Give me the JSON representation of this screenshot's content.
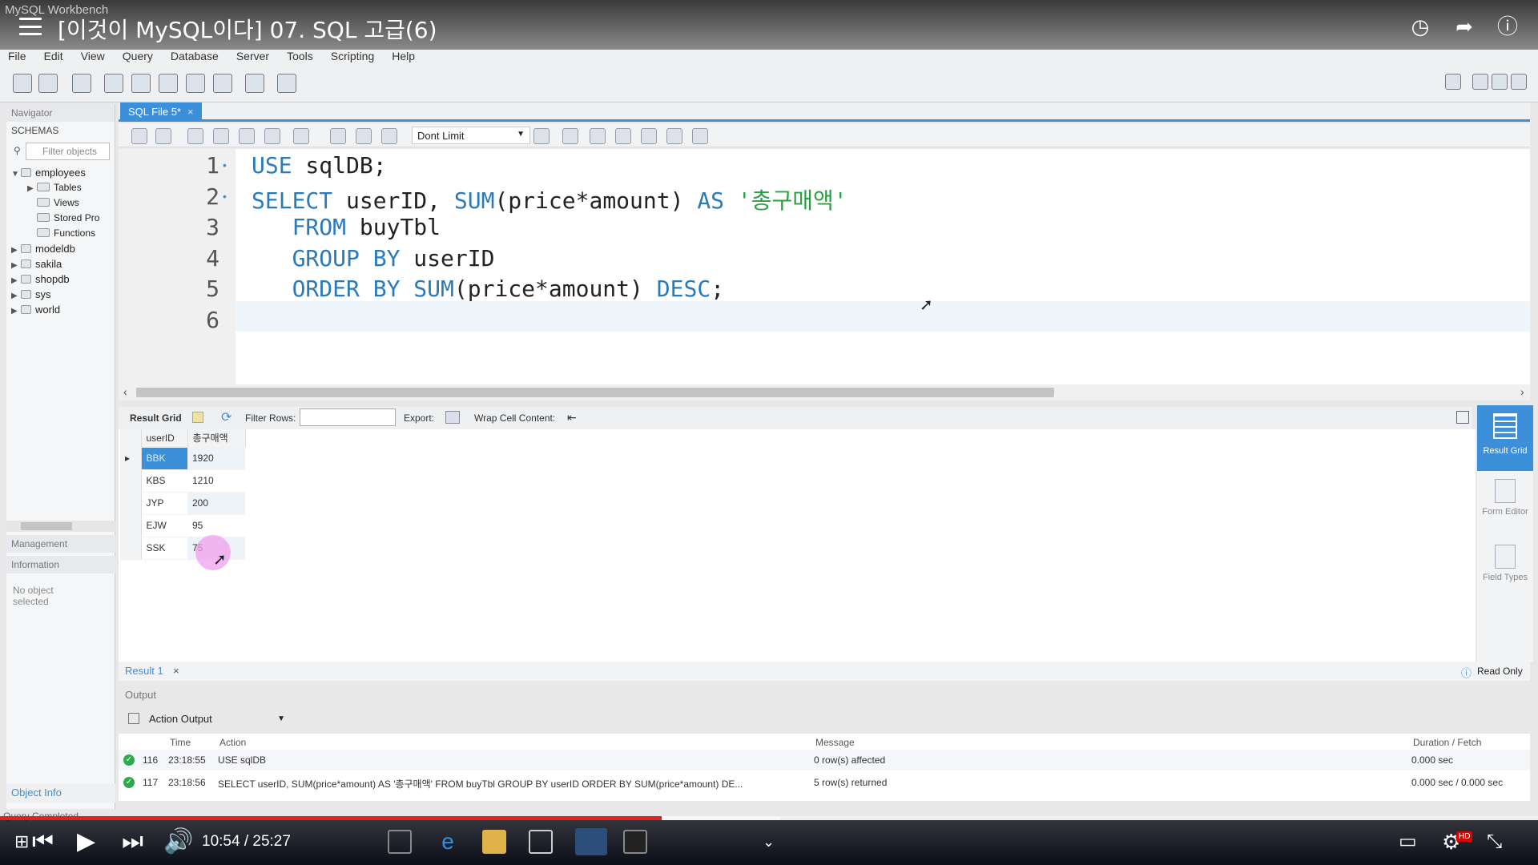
{
  "app": {
    "window_title": "MySQL Workbench",
    "video_title": "[이것이 MySQL이다] 07. SQL 고급(6)"
  },
  "menu": [
    "File",
    "Edit",
    "View",
    "Query",
    "Database",
    "Server",
    "Tools",
    "Scripting",
    "Help"
  ],
  "navigator": {
    "header": "Navigator",
    "schemas_label": "SCHEMAS",
    "filter_placeholder": "Filter objects",
    "schemas": [
      {
        "name": "employees",
        "expanded": true,
        "children": [
          "Tables",
          "Views",
          "Stored Pro",
          "Functions"
        ]
      },
      {
        "name": "modeldb"
      },
      {
        "name": "sakila"
      },
      {
        "name": "shopdb"
      },
      {
        "name": "sys"
      },
      {
        "name": "world"
      }
    ],
    "management_label": "Management",
    "information_label": "Information",
    "no_object": "No object selected",
    "object_info": "Object Info"
  },
  "editor": {
    "tab_label": "SQL File 5*",
    "limit_value": "Dont Limit",
    "lines": [
      {
        "n": "1",
        "html": "<span class='kw'>USE</span> sqlDB;"
      },
      {
        "n": "2",
        "html": "<span class='kw'>SELECT</span> userID, <span class='kw'>SUM</span>(price*amount) <span class='kw'>AS</span> <span class='str'>'총구매액'</span>"
      },
      {
        "n": "3",
        "html": "   <span class='kw'>FROM</span> buyTbl"
      },
      {
        "n": "4",
        "html": "   <span class='kw'>GROUP BY</span> userID"
      },
      {
        "n": "5",
        "html": "   <span class='kw'>ORDER BY</span> <span class='kw'>SUM</span>(price*amount) <span class='kw'>DESC</span>;"
      },
      {
        "n": "6",
        "html": ""
      }
    ]
  },
  "result_toolbar": {
    "result_grid": "Result Grid",
    "filter_rows": "Filter Rows:",
    "export": "Export:",
    "wrap": "Wrap Cell Content:"
  },
  "result": {
    "columns": [
      "userID",
      "총구매액"
    ],
    "rows": [
      [
        "BBK",
        "1920"
      ],
      [
        "KBS",
        "1210"
      ],
      [
        "JYP",
        "200"
      ],
      [
        "EJW",
        "95"
      ],
      [
        "SSK",
        "75"
      ]
    ],
    "tab_label": "Result 1",
    "read_only": "Read Only",
    "side": [
      "Result Grid",
      "Form Editor",
      "Field Types"
    ]
  },
  "output": {
    "header": "Output",
    "selector": "Action Output",
    "columns": [
      "Time",
      "Action",
      "Message",
      "Duration / Fetch"
    ],
    "rows": [
      {
        "num": "116",
        "time": "23:18:55",
        "action": "USE sqlDB",
        "message": "0 row(s) affected",
        "duration": "0.000 sec"
      },
      {
        "num": "117",
        "time": "23:18:56",
        "action": "SELECT userID, SUM(price*amount) AS '총구매액'   FROM buyTbl   GROUP BY userID   ORDER BY SUM(price*amount) DE...",
        "message": "5 row(s) returned",
        "duration": "0.000 sec / 0.000 sec"
      }
    ]
  },
  "status": "Query Completed",
  "player": {
    "time": "10:54 / 25:27",
    "hd": "HD",
    "progress_fraction": 0.43
  },
  "colors": {
    "accent": "#3c8fd9",
    "keyword": "#2a7ab8",
    "string": "#2aa044",
    "progress": "#e62117"
  }
}
